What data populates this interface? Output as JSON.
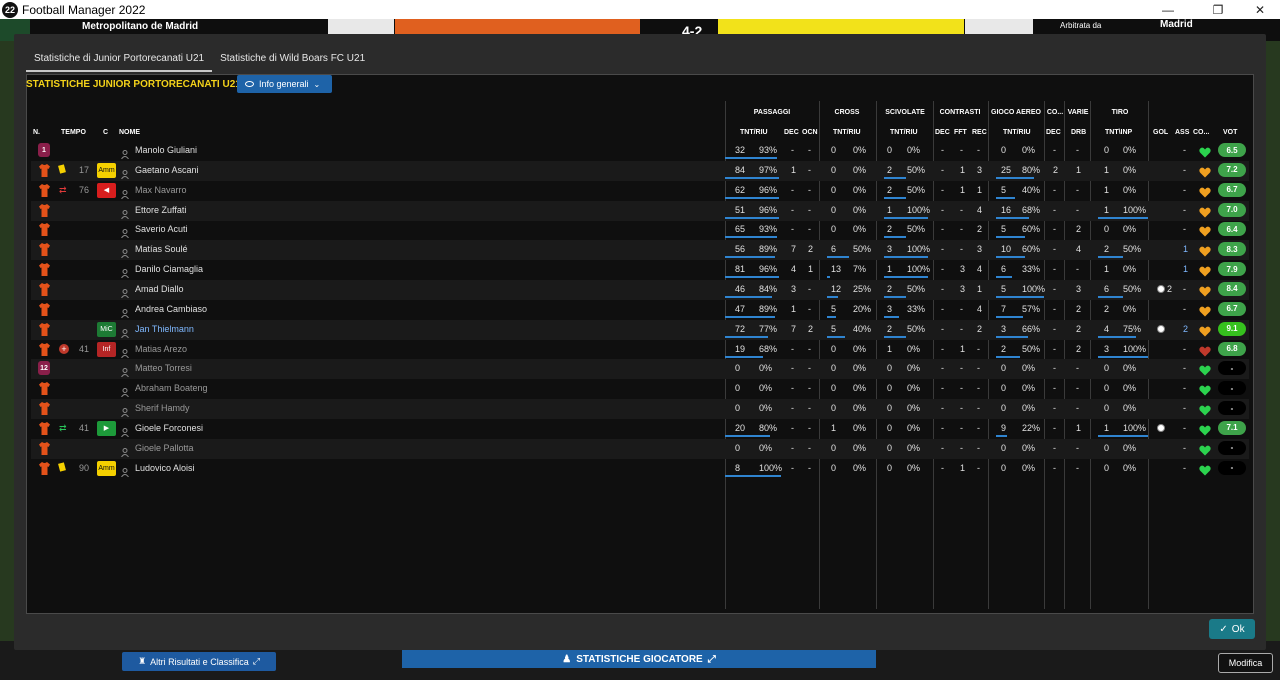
{
  "window": {
    "title": "Football Manager 2022",
    "app_badge": "22",
    "controls": [
      "—",
      "❐",
      "✕"
    ]
  },
  "background": {
    "venue": "Metropolitano de Madrid",
    "referee_label": "Arbitrata da",
    "referee_city": "Madrid",
    "scoreboard": "4-2"
  },
  "tabs": [
    {
      "label": "Statistiche di Junior Portorecanati U21",
      "active": true
    },
    {
      "label": "Statistiche di Wild Boars FC U21",
      "active": false
    }
  ],
  "panel": {
    "title": "STATISTICHE JUNIOR PORTORECANATI U21",
    "view_button": "Info generali"
  },
  "groups": {
    "passaggi": "PASSAGGI",
    "cross": "CROSS",
    "scivolate": "SCIVOLATE",
    "contrasti": "CONTRASTI",
    "gioco_aereo": "GIOCO AEREO",
    "co": "CO...",
    "varie": "VARIE",
    "tiro": "TIRO"
  },
  "headers": {
    "n": "N.",
    "tempo": "TEMPO",
    "c": "C",
    "nome": "NOME",
    "pass_tnt": "TNT/RIU",
    "dec": "DEC",
    "ocn": "OCN",
    "cross_tnt": "TNT/RIU",
    "sciv_tnt": "TNT/RIU",
    "con_dec": "DEC",
    "fft": "FFT",
    "rec": "REC",
    "aereo_tnt": "TNT/RIU",
    "co_dec": "DEC",
    "drb": "DRB",
    "tiro_tnt": "TNT\\INP",
    "gol": "GOL",
    "ass": "ASS",
    "co2": "CO...",
    "vot": "VOT"
  },
  "players": [
    {
      "num": "1",
      "gk": true,
      "tempo": "",
      "event": "",
      "role": "",
      "name": "Manolo Giuliani",
      "active": true,
      "pass_t": "32",
      "pass_p": "93%",
      "pass_fill": 0.93,
      "dec": "-",
      "ocn": "-",
      "cross_t": "0",
      "cross_p": "0%",
      "cross_fill": 0,
      "sciv_t": "0",
      "sciv_p": "0%",
      "sciv_fill": 0,
      "cdec": "-",
      "fft": "-",
      "rec": "-",
      "aer_t": "0",
      "aer_p": "0%",
      "aer_fill": 0,
      "codec": "-",
      "drb": "-",
      "tiro_t": "0",
      "tiro_p": "0%",
      "tiro_fill": 0,
      "gol": "",
      "ass": "-",
      "cond": "green",
      "vot": "6.5",
      "vot_color": "#3ea34a"
    },
    {
      "num": "",
      "gk": false,
      "tempo": "17",
      "event": "yellow",
      "role": "Amm",
      "name": "Gaetano Ascani",
      "active": true,
      "pass_t": "84",
      "pass_p": "97%",
      "pass_fill": 0.97,
      "dec": "1",
      "ocn": "-",
      "cross_t": "0",
      "cross_p": "0%",
      "cross_fill": 0,
      "sciv_t": "2",
      "sciv_p": "50%",
      "sciv_fill": 0.5,
      "cdec": "-",
      "fft": "1",
      "rec": "3",
      "aer_t": "25",
      "aer_p": "80%",
      "aer_fill": 0.8,
      "codec": "2",
      "drb": "1",
      "tiro_t": "1",
      "tiro_p": "0%",
      "tiro_fill": 0,
      "gol": "",
      "ass": "-",
      "cond": "orange",
      "vot": "7.2",
      "vot_color": "#3ea34a"
    },
    {
      "num": "",
      "gk": false,
      "tempo": "76",
      "event": "subout",
      "role": "◀",
      "name": "Max Navarro",
      "active": false,
      "pass_t": "62",
      "pass_p": "96%",
      "pass_fill": 0.96,
      "dec": "-",
      "ocn": "-",
      "cross_t": "0",
      "cross_p": "0%",
      "cross_fill": 0,
      "sciv_t": "2",
      "sciv_p": "50%",
      "sciv_fill": 0.5,
      "cdec": "-",
      "fft": "1",
      "rec": "1",
      "aer_t": "5",
      "aer_p": "40%",
      "aer_fill": 0.4,
      "codec": "-",
      "drb": "-",
      "tiro_t": "1",
      "tiro_p": "0%",
      "tiro_fill": 0,
      "gol": "",
      "ass": "-",
      "cond": "orange",
      "vot": "6.7",
      "vot_color": "#3ea34a"
    },
    {
      "num": "",
      "gk": false,
      "tempo": "",
      "event": "",
      "role": "",
      "name": "Ettore Zuffati",
      "active": true,
      "pass_t": "51",
      "pass_p": "96%",
      "pass_fill": 0.96,
      "dec": "-",
      "ocn": "-",
      "cross_t": "0",
      "cross_p": "0%",
      "cross_fill": 0,
      "sciv_t": "1",
      "sciv_p": "100%",
      "sciv_fill": 1,
      "cdec": "-",
      "fft": "-",
      "rec": "4",
      "aer_t": "16",
      "aer_p": "68%",
      "aer_fill": 0.68,
      "codec": "-",
      "drb": "-",
      "tiro_t": "1",
      "tiro_p": "100%",
      "tiro_fill": 1,
      "gol": "",
      "ass": "-",
      "cond": "orange",
      "vot": "7.0",
      "vot_color": "#3ea34a"
    },
    {
      "num": "",
      "gk": false,
      "tempo": "",
      "event": "",
      "role": "",
      "name": "Saverio Acuti",
      "active": true,
      "pass_t": "65",
      "pass_p": "93%",
      "pass_fill": 0.93,
      "dec": "-",
      "ocn": "-",
      "cross_t": "0",
      "cross_p": "0%",
      "cross_fill": 0,
      "sciv_t": "2",
      "sciv_p": "50%",
      "sciv_fill": 0.5,
      "cdec": "-",
      "fft": "-",
      "rec": "2",
      "aer_t": "5",
      "aer_p": "60%",
      "aer_fill": 0.6,
      "codec": "-",
      "drb": "2",
      "tiro_t": "0",
      "tiro_p": "0%",
      "tiro_fill": 0,
      "gol": "",
      "ass": "-",
      "cond": "orange",
      "vot": "6.4",
      "vot_color": "#3ea34a"
    },
    {
      "num": "",
      "gk": false,
      "tempo": "",
      "event": "",
      "role": "",
      "name": "Matías Soulé",
      "active": true,
      "pass_t": "56",
      "pass_p": "89%",
      "pass_fill": 0.89,
      "dec": "7",
      "ocn": "2",
      "cross_t": "6",
      "cross_p": "50%",
      "cross_fill": 0.5,
      "sciv_t": "3",
      "sciv_p": "100%",
      "sciv_fill": 1,
      "cdec": "-",
      "fft": "-",
      "rec": "3",
      "aer_t": "10",
      "aer_p": "60%",
      "aer_fill": 0.6,
      "codec": "-",
      "drb": "4",
      "tiro_t": "2",
      "tiro_p": "50%",
      "tiro_fill": 0.5,
      "gol": "",
      "ass": "1",
      "cond": "orange",
      "vot": "8.3",
      "vot_color": "#3ea34a"
    },
    {
      "num": "",
      "gk": false,
      "tempo": "",
      "event": "",
      "role": "",
      "name": "Danilo Ciamaglia",
      "active": true,
      "pass_t": "81",
      "pass_p": "96%",
      "pass_fill": 0.96,
      "dec": "4",
      "ocn": "1",
      "cross_t": "13",
      "cross_p": "7%",
      "cross_fill": 0.07,
      "sciv_t": "1",
      "sciv_p": "100%",
      "sciv_fill": 1,
      "cdec": "-",
      "fft": "3",
      "rec": "4",
      "aer_t": "6",
      "aer_p": "33%",
      "aer_fill": 0.33,
      "codec": "-",
      "drb": "-",
      "tiro_t": "1",
      "tiro_p": "0%",
      "tiro_fill": 0,
      "gol": "",
      "ass": "1",
      "cond": "orange",
      "vot": "7.9",
      "vot_color": "#3ea34a"
    },
    {
      "num": "",
      "gk": false,
      "tempo": "",
      "event": "",
      "role": "",
      "name": "Amad Diallo",
      "active": true,
      "pass_t": "46",
      "pass_p": "84%",
      "pass_fill": 0.84,
      "dec": "3",
      "ocn": "-",
      "cross_t": "12",
      "cross_p": "25%",
      "cross_fill": 0.25,
      "sciv_t": "2",
      "sciv_p": "50%",
      "sciv_fill": 0.5,
      "cdec": "-",
      "fft": "3",
      "rec": "1",
      "aer_t": "5",
      "aer_p": "100%",
      "aer_fill": 1,
      "codec": "-",
      "drb": "3",
      "tiro_t": "6",
      "tiro_p": "50%",
      "tiro_fill": 0.5,
      "gol": "2",
      "ass": "-",
      "cond": "orange",
      "vot": "8.4",
      "vot_color": "#3ea34a"
    },
    {
      "num": "",
      "gk": false,
      "tempo": "",
      "event": "",
      "role": "",
      "name": "Andrea Cambiaso",
      "active": true,
      "pass_t": "47",
      "pass_p": "89%",
      "pass_fill": 0.89,
      "dec": "1",
      "ocn": "-",
      "cross_t": "5",
      "cross_p": "20%",
      "cross_fill": 0.2,
      "sciv_t": "3",
      "sciv_p": "33%",
      "sciv_fill": 0.33,
      "cdec": "-",
      "fft": "-",
      "rec": "4",
      "aer_t": "7",
      "aer_p": "57%",
      "aer_fill": 0.57,
      "codec": "-",
      "drb": "2",
      "tiro_t": "2",
      "tiro_p": "0%",
      "tiro_fill": 0,
      "gol": "",
      "ass": "-",
      "cond": "orange",
      "vot": "6.7",
      "vot_color": "#3ea34a"
    },
    {
      "num": "",
      "gk": false,
      "tempo": "",
      "event": "",
      "role": "MiC",
      "name": "Jan Thielmann",
      "active": true,
      "mom": true,
      "pass_t": "72",
      "pass_p": "77%",
      "pass_fill": 0.77,
      "dec": "7",
      "ocn": "2",
      "cross_t": "5",
      "cross_p": "40%",
      "cross_fill": 0.4,
      "sciv_t": "2",
      "sciv_p": "50%",
      "sciv_fill": 0.5,
      "cdec": "-",
      "fft": "-",
      "rec": "2",
      "aer_t": "3",
      "aer_p": "66%",
      "aer_fill": 0.66,
      "codec": "-",
      "drb": "2",
      "tiro_t": "4",
      "tiro_p": "75%",
      "tiro_fill": 0.75,
      "gol": "1",
      "ass": "2",
      "cond": "orange",
      "vot": "9.1",
      "vot_color": "#36c11e"
    },
    {
      "num": "",
      "gk": false,
      "tempo": "41",
      "event": "injury",
      "role": "Inf",
      "name": "Matias Arezo",
      "active": false,
      "pass_t": "19",
      "pass_p": "68%",
      "pass_fill": 0.68,
      "dec": "-",
      "ocn": "-",
      "cross_t": "0",
      "cross_p": "0%",
      "cross_fill": 0,
      "sciv_t": "1",
      "sciv_p": "0%",
      "sciv_fill": 0,
      "cdec": "-",
      "fft": "1",
      "rec": "-",
      "aer_t": "2",
      "aer_p": "50%",
      "aer_fill": 0.5,
      "codec": "-",
      "drb": "2",
      "tiro_t": "3",
      "tiro_p": "100%",
      "tiro_fill": 1,
      "gol": "",
      "ass": "-",
      "cond": "red",
      "vot": "6.8",
      "vot_color": "#3ea34a"
    },
    {
      "num": "12",
      "gk": true,
      "tempo": "",
      "event": "",
      "role": "",
      "name": "Matteo Torresi",
      "active": false,
      "pass_t": "0",
      "pass_p": "0%",
      "pass_fill": 0,
      "dec": "-",
      "ocn": "-",
      "cross_t": "0",
      "cross_p": "0%",
      "cross_fill": 0,
      "sciv_t": "0",
      "sciv_p": "0%",
      "sciv_fill": 0,
      "cdec": "-",
      "fft": "-",
      "rec": "-",
      "aer_t": "0",
      "aer_p": "0%",
      "aer_fill": 0,
      "codec": "-",
      "drb": "-",
      "tiro_t": "0",
      "tiro_p": "0%",
      "tiro_fill": 0,
      "gol": "",
      "ass": "-",
      "cond": "green",
      "vot": "-",
      "vot_color": "#000"
    },
    {
      "num": "",
      "gk": false,
      "tempo": "",
      "event": "",
      "role": "",
      "name": "Abraham Boateng",
      "active": false,
      "pass_t": "0",
      "pass_p": "0%",
      "pass_fill": 0,
      "dec": "-",
      "ocn": "-",
      "cross_t": "0",
      "cross_p": "0%",
      "cross_fill": 0,
      "sciv_t": "0",
      "sciv_p": "0%",
      "sciv_fill": 0,
      "cdec": "-",
      "fft": "-",
      "rec": "-",
      "aer_t": "0",
      "aer_p": "0%",
      "aer_fill": 0,
      "codec": "-",
      "drb": "-",
      "tiro_t": "0",
      "tiro_p": "0%",
      "tiro_fill": 0,
      "gol": "",
      "ass": "-",
      "cond": "green",
      "vot": "-",
      "vot_color": "#000"
    },
    {
      "num": "",
      "gk": false,
      "tempo": "",
      "event": "",
      "role": "",
      "name": "Sherif Hamdy",
      "active": false,
      "pass_t": "0",
      "pass_p": "0%",
      "pass_fill": 0,
      "dec": "-",
      "ocn": "-",
      "cross_t": "0",
      "cross_p": "0%",
      "cross_fill": 0,
      "sciv_t": "0",
      "sciv_p": "0%",
      "sciv_fill": 0,
      "cdec": "-",
      "fft": "-",
      "rec": "-",
      "aer_t": "0",
      "aer_p": "0%",
      "aer_fill": 0,
      "codec": "-",
      "drb": "-",
      "tiro_t": "0",
      "tiro_p": "0%",
      "tiro_fill": 0,
      "gol": "",
      "ass": "-",
      "cond": "green",
      "vot": "-",
      "vot_color": "#000"
    },
    {
      "num": "",
      "gk": false,
      "tempo": "41",
      "event": "subin",
      "role": "▶",
      "name": "Gioele Forconesi",
      "active": true,
      "pass_t": "20",
      "pass_p": "80%",
      "pass_fill": 0.8,
      "dec": "-",
      "ocn": "-",
      "cross_t": "1",
      "cross_p": "0%",
      "cross_fill": 0,
      "sciv_t": "0",
      "sciv_p": "0%",
      "sciv_fill": 0,
      "cdec": "-",
      "fft": "-",
      "rec": "-",
      "aer_t": "9",
      "aer_p": "22%",
      "aer_fill": 0.22,
      "codec": "-",
      "drb": "1",
      "tiro_t": "1",
      "tiro_p": "100%",
      "tiro_fill": 1,
      "gol": "1",
      "ass": "-",
      "cond": "green",
      "vot": "7.1",
      "vot_color": "#3ea34a"
    },
    {
      "num": "",
      "gk": false,
      "tempo": "",
      "event": "",
      "role": "",
      "name": "Gioele Pallotta",
      "active": false,
      "pass_t": "0",
      "pass_p": "0%",
      "pass_fill": 0,
      "dec": "-",
      "ocn": "-",
      "cross_t": "0",
      "cross_p": "0%",
      "cross_fill": 0,
      "sciv_t": "0",
      "sciv_p": "0%",
      "sciv_fill": 0,
      "cdec": "-",
      "fft": "-",
      "rec": "-",
      "aer_t": "0",
      "aer_p": "0%",
      "aer_fill": 0,
      "codec": "-",
      "drb": "-",
      "tiro_t": "0",
      "tiro_p": "0%",
      "tiro_fill": 0,
      "gol": "",
      "ass": "-",
      "cond": "green",
      "vot": "-",
      "vot_color": "#000"
    },
    {
      "num": "",
      "gk": false,
      "tempo": "90",
      "event": "yellow",
      "role": "Amm",
      "name": "Ludovico Aloisi",
      "active": true,
      "pass_t": "8",
      "pass_p": "100%",
      "pass_fill": 1,
      "dec": "-",
      "ocn": "-",
      "cross_t": "0",
      "cross_p": "0%",
      "cross_fill": 0,
      "sciv_t": "0",
      "sciv_p": "0%",
      "sciv_fill": 0,
      "cdec": "-",
      "fft": "1",
      "rec": "-",
      "aer_t": "0",
      "aer_p": "0%",
      "aer_fill": 0,
      "codec": "-",
      "drb": "-",
      "tiro_t": "0",
      "tiro_p": "0%",
      "tiro_fill": 0,
      "gol": "",
      "ass": "-",
      "cond": "green",
      "vot": "-",
      "vot_color": "#000"
    }
  ],
  "buttons": {
    "ok": "Ok",
    "altri_risultati": "Altri Risultati e Classifica",
    "statistiche_giocatore": "STATISTICHE GIOCATORE",
    "modifica": "Modifica"
  },
  "colors": {
    "accent_title": "#f3d21a",
    "button_blue": "#1e63a8",
    "ok_teal": "#1a7a88",
    "shirt_orange": "#e4521a",
    "gk_badge": "#8a1f4a"
  }
}
